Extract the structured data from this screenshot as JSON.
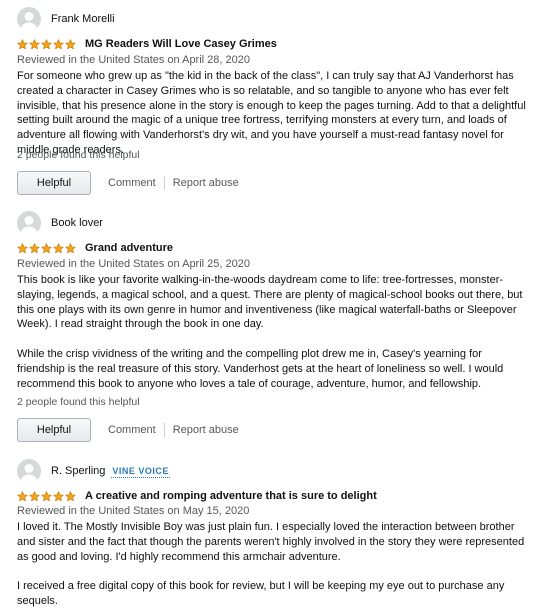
{
  "colors": {
    "star": "#f4a41c",
    "text": "#0f1111",
    "secondary": "#565959",
    "vine": "#2a7bb6"
  },
  "icons": {
    "avatar": "default-profile-icon",
    "star": "star-icon"
  },
  "reviews": [
    {
      "reviewer": "Frank Morelli",
      "badge": "",
      "rating": 5,
      "title": "MG Readers Will Love Casey Grimes",
      "date": "Reviewed in the United States on April 28, 2020",
      "body": [
        "For someone who grew up as \"the kid in the back of the class\", I can truly say that AJ Vanderhorst has created a character in Casey Grimes who is so relatable, and so tangible to anyone who has ever felt invisible, that his presence alone in the story is enough to keep the pages turning. Add to that a delightful setting built around the magic of a unique tree fortress, terrifying monsters at every turn, and loads of adventure all flowing with Vanderhorst's dry wit, and you have yourself a must-read fantasy novel for middle grade readers."
      ],
      "helpful_text": "2 people found this helpful",
      "helpful_button": "Helpful",
      "comment_label": "Comment",
      "report_label": "Report abuse"
    },
    {
      "reviewer": "Book lover",
      "badge": "",
      "rating": 5,
      "title": "Grand adventure",
      "date": "Reviewed in the United States on April 25, 2020",
      "body": [
        "This book is like your favorite walking-in-the-woods daydream come to life: tree-fortresses, monster-slaying, legends, a magical school, and a quest. There are plenty of magical-school books out there, but this one plays with its own genre in humor and inventiveness (like magical waterfall-baths or Sleepover Week). I read straight through the book in one day.",
        "While the crisp vividness of the writing and the compelling plot drew me in, Casey's yearning for friendship is the real treasure of this story. Vanderhost gets at the heart of loneliness so well. I would recommend this book to anyone who loves a tale of courage, adventure, humor, and fellowship."
      ],
      "helpful_text": "2 people found this helpful",
      "helpful_button": "Helpful",
      "comment_label": "Comment",
      "report_label": "Report abuse"
    },
    {
      "reviewer": "R. Sperling",
      "badge": "VINE VOICE",
      "rating": 5,
      "title": "A creative and romping adventure that is sure to delight",
      "date": "Reviewed in the United States on May 15, 2020",
      "body": [
        "I loved it. The Mostly Invisible Boy was just plain fun. I especially loved the interaction between brother and sister and the fact that though the parents weren't highly involved in the story they were represented as good and loving. I'd highly recommend this armchair adventure.",
        "I received a free digital copy of this book for review, but I will be keeping my eye out to purchase any sequels."
      ]
    }
  ]
}
